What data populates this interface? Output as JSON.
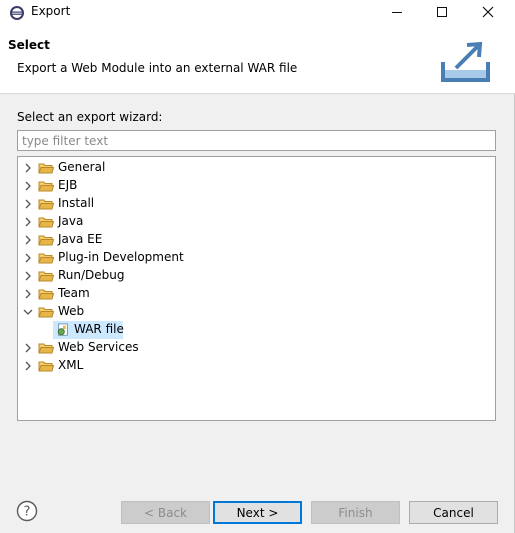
{
  "window": {
    "title": "Export",
    "minimize_glyph": "—",
    "maximize_glyph": "☐",
    "close_glyph": "✕"
  },
  "banner": {
    "title": "Select",
    "description": "Export a Web Module into an external WAR file",
    "icon": "export-wizard-icon"
  },
  "wizard": {
    "label": "Select an export wizard:",
    "filter_placeholder": "type filter text",
    "filter_value": ""
  },
  "tree": {
    "items": [
      {
        "label": "General",
        "expanded": false
      },
      {
        "label": "EJB",
        "expanded": false
      },
      {
        "label": "Install",
        "expanded": false
      },
      {
        "label": "Java",
        "expanded": false
      },
      {
        "label": "Java EE",
        "expanded": false
      },
      {
        "label": "Plug-in Development",
        "expanded": false
      },
      {
        "label": "Run/Debug",
        "expanded": false
      },
      {
        "label": "Team",
        "expanded": false
      },
      {
        "label": "Web",
        "expanded": true
      },
      {
        "label": "WAR file",
        "child": true,
        "selected": true
      },
      {
        "label": "Web Services",
        "expanded": false
      },
      {
        "label": "XML",
        "expanded": false
      }
    ]
  },
  "footer": {
    "help_icon": "help-icon",
    "back_label": "< Back",
    "next_label": "Next >",
    "finish_label": "Finish",
    "cancel_label": "Cancel"
  },
  "colors": {
    "selection": "#cce8ff",
    "default_button_border": "#0078d7",
    "folder": "#e8b54a"
  }
}
